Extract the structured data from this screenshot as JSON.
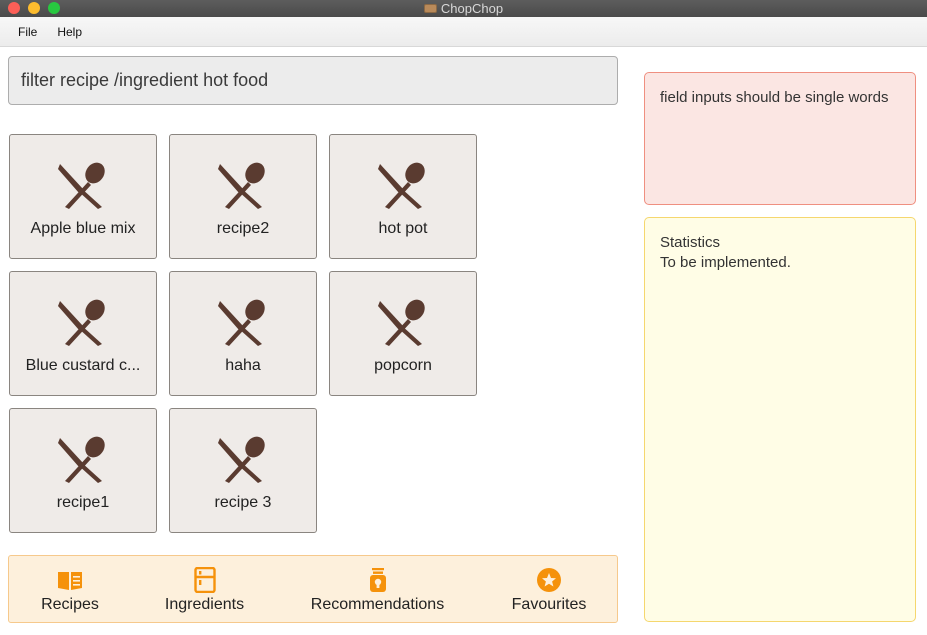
{
  "window": {
    "title": "ChopChop"
  },
  "menu": {
    "items": [
      "File",
      "Help"
    ]
  },
  "command": {
    "value": "filter recipe /ingredient hot food"
  },
  "recipes": [
    {
      "name": "Apple blue mix",
      "icon": "fork-spoon-icon"
    },
    {
      "name": "recipe2",
      "icon": "fork-spoon-icon"
    },
    {
      "name": "hot pot",
      "icon": "fork-spoon-icon"
    },
    {
      "name": "Blue custard c...",
      "icon": "fork-spoon-icon"
    },
    {
      "name": "haha",
      "icon": "fork-spoon-icon"
    },
    {
      "name": "popcorn",
      "icon": "fork-spoon-icon"
    },
    {
      "name": "recipe1",
      "icon": "fork-spoon-icon"
    },
    {
      "name": "recipe 3",
      "icon": "fork-spoon-icon"
    }
  ],
  "nav": {
    "tabs": [
      {
        "label": "Recipes",
        "icon": "book-icon"
      },
      {
        "label": "Ingredients",
        "icon": "fridge-icon"
      },
      {
        "label": "Recommendations",
        "icon": "jar-icon"
      },
      {
        "label": "Favourites",
        "icon": "star-icon"
      }
    ]
  },
  "result": {
    "text": "field inputs should be single words"
  },
  "stats": {
    "title": "Statistics",
    "body": "To be implemented."
  },
  "colors": {
    "accent": "#f5920b",
    "icon_brown": "#5a3b30",
    "result_bg": "#fbe6e3",
    "stats_bg": "#fffde6",
    "nav_bg": "#fdf0dc"
  }
}
